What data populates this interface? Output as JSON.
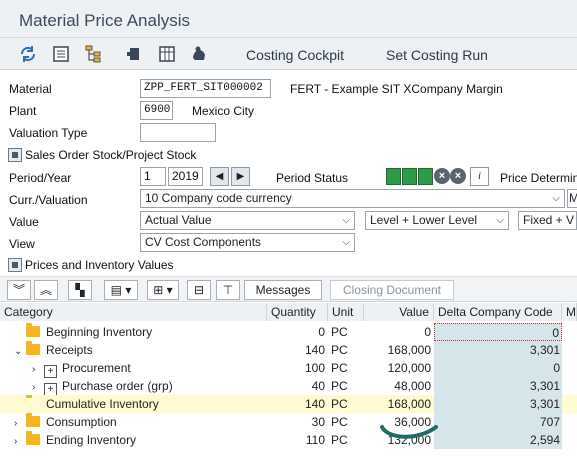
{
  "title": "Material Price Analysis",
  "toolbar": {
    "icons": [
      "refresh-icon",
      "document-icon",
      "hierarchy-icon",
      "cube-icon",
      "table-icon",
      "hand-icon"
    ],
    "costing_cockpit": "Costing Cockpit",
    "set_costing_run": "Set Costing Run"
  },
  "form": {
    "material_label": "Material",
    "material_value": "ZPP_FERT_SIT000002",
    "material_desc": "FERT - Example SIT XCompany Margin",
    "plant_label": "Plant",
    "plant_value": "6900",
    "plant_desc": "Mexico City",
    "valuation_type_label": "Valuation Type",
    "valuation_type_value": "",
    "sales_order_stock": "Sales Order Stock/Project Stock",
    "period_label": "Period/Year",
    "period_value": "1",
    "year_value": "2019",
    "period_status_label": "Period Status",
    "price_determination": "Price Determin",
    "curr_label": "Curr./Valuation",
    "curr_value": "10 Company code currency",
    "curr_btn": "M",
    "value_label": "Value",
    "value_value": "Actual Value",
    "level_value": "Level + Lower Level",
    "fixed_value": "Fixed + V",
    "view_label": "View",
    "view_value": "CV Cost Components",
    "prices_inventory": "Prices and Inventory Values"
  },
  "grid_toolbar": {
    "messages": "Messages",
    "closing_document": "Closing Document"
  },
  "columns": {
    "category": "Category",
    "quantity": "Quantity",
    "unit": "Unit",
    "value": "Value",
    "delta": "Delta Company Code",
    "extra": "M"
  },
  "rows": [
    {
      "category": "Beginning Inventory",
      "quantity": "0",
      "unit": "PC",
      "value": "0",
      "delta": "0"
    },
    {
      "category": "Receipts",
      "quantity": "140",
      "unit": "PC",
      "value": "168,000",
      "delta": "3,301"
    },
    {
      "category": "Procurement",
      "quantity": "100",
      "unit": "PC",
      "value": "120,000",
      "delta": "0"
    },
    {
      "category": "Purchase order (grp)",
      "quantity": "40",
      "unit": "PC",
      "value": "48,000",
      "delta": "3,301"
    },
    {
      "category": "Cumulative Inventory",
      "quantity": "140",
      "unit": "PC",
      "value": "168,000",
      "delta": "3,301"
    },
    {
      "category": "Consumption",
      "quantity": "30",
      "unit": "PC",
      "value": "36,000",
      "delta": "707"
    },
    {
      "category": "Ending Inventory",
      "quantity": "110",
      "unit": "PC",
      "value": "132,000",
      "delta": "2,594"
    }
  ],
  "colors": {
    "accent": "#2e9b4a",
    "highlight": "#fefbd0",
    "delta_bg": "#d6e5ea",
    "folder": "#f4b521"
  }
}
